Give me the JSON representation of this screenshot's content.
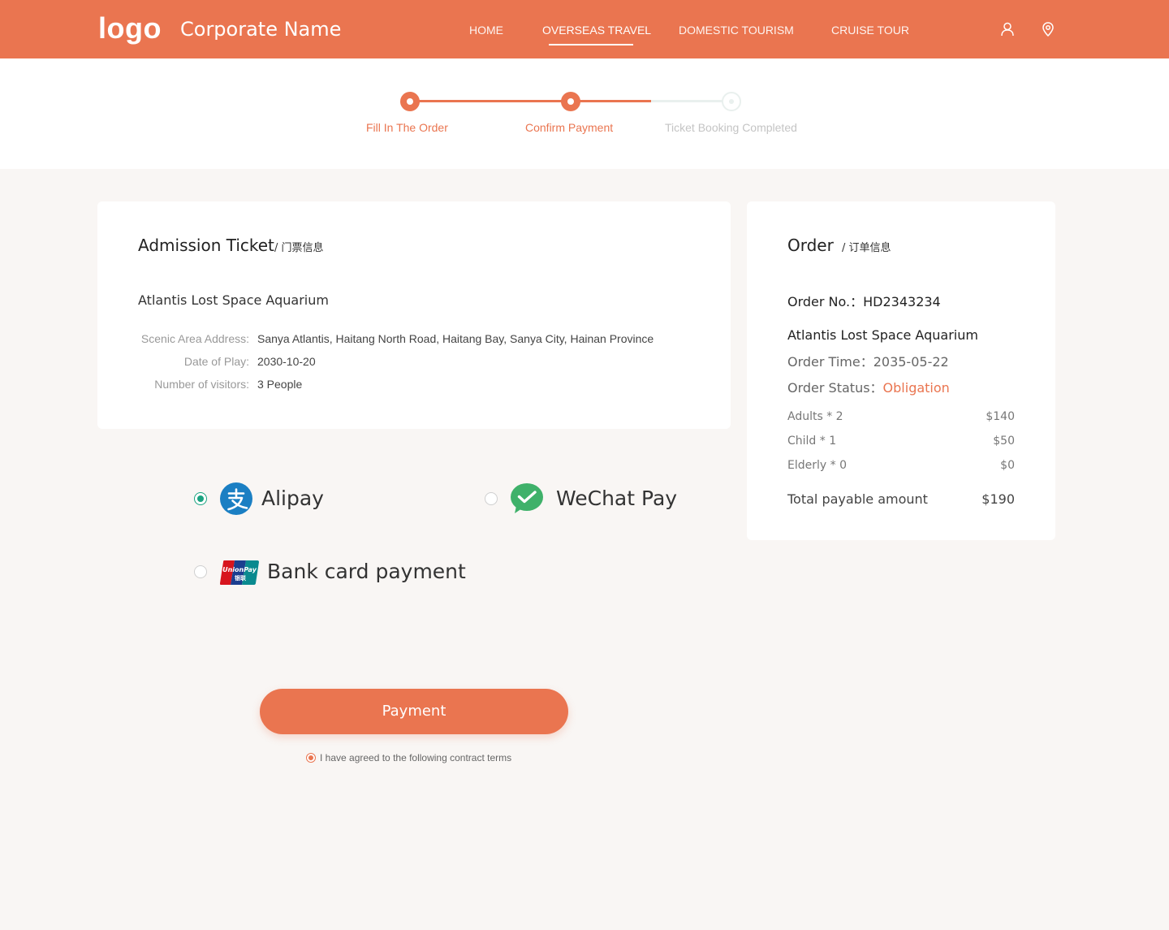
{
  "header": {
    "logo": "logo",
    "corporate_name": "Corporate Name",
    "nav": [
      "HOME",
      "OVERSEAS TRAVEL",
      "DOMESTIC TOURISM",
      "CRUISE TOUR"
    ],
    "active_nav": "OVERSEAS TRAVEL",
    "icons": [
      "user-icon",
      "location-pin-icon"
    ]
  },
  "steps": [
    {
      "label": "Fill In The Order",
      "state": "done"
    },
    {
      "label": "Confirm Payment",
      "state": "done"
    },
    {
      "label": "Ticket Booking Completed",
      "state": "pending"
    }
  ],
  "ticket": {
    "title": "Admission Ticket",
    "subtitle": "/ 门票信息",
    "attraction": "Atlantis Lost Space Aquarium",
    "fields": [
      {
        "label": "Scenic Area Address:",
        "value": "Sanya Atlantis, Haitang North Road, Haitang Bay, Sanya City, Hainan Province"
      },
      {
        "label": "Date of Play:",
        "value": "2030-10-20"
      },
      {
        "label": "Number of visitors:",
        "value": "3 People"
      }
    ]
  },
  "order": {
    "title": "Order",
    "subtitle": "/ 订单信息",
    "order_no": "Order No.：HD2343234",
    "attraction": "Atlantis Lost Space Aquarium",
    "order_time": "Order Time：2035-05-22",
    "status_label": "Order Status：",
    "status_value": "Obligation",
    "items": [
      {
        "name": "Adults * 2",
        "price": "$140"
      },
      {
        "name": "Child * 1",
        "price": "$50"
      },
      {
        "name": "Elderly * 0",
        "price": "$0"
      }
    ],
    "total_label": "Total payable amount",
    "total_value": "$190"
  },
  "payment": {
    "options": [
      {
        "label": "Alipay",
        "icon": "alipay-icon",
        "selected": true
      },
      {
        "label": "WeChat Pay",
        "icon": "wechat-pay-icon",
        "selected": false
      },
      {
        "label": "Bank card payment",
        "icon": "unionpay-icon",
        "selected": false
      }
    ],
    "button_label": "Payment",
    "agreement": "I have agreed to the following contract terms"
  },
  "colors": {
    "accent": "#ea7550",
    "alipay": "#1b7fc3",
    "wechat": "#3fb16a",
    "radio_selected": "#1aa380"
  }
}
